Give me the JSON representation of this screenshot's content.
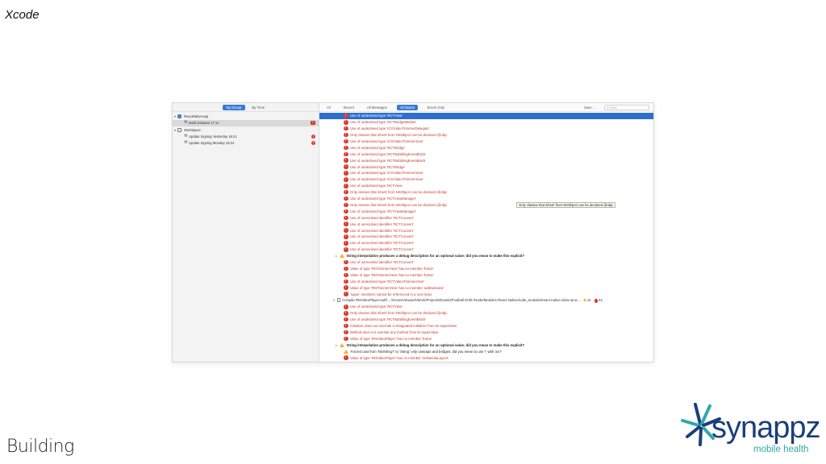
{
  "slide": {
    "title": "Xcode",
    "footer": "Building"
  },
  "navigator": {
    "segments": [
      "By Group",
      "By Time"
    ],
    "active_segment": "By Group",
    "rows": [
      {
        "label": "ReactNativeApp",
        "kind": "project",
        "indent": 0
      },
      {
        "label": "Build Dalsetar 17:11",
        "kind": "build",
        "indent": 1,
        "selected": true,
        "badge": "!"
      },
      {
        "label": "Workspace",
        "kind": "workspace",
        "indent": 0
      },
      {
        "label": "Update Signing Yesterday 18:41",
        "kind": "build",
        "indent": 1,
        "badge": "!"
      },
      {
        "label": "Update Signing Monday 15:24",
        "kind": "build",
        "indent": 1,
        "badge": "!"
      }
    ]
  },
  "toolbar": {
    "all": "All",
    "recent": "Recent",
    "all_messages": "All Messages",
    "all_issues": "All Issues",
    "errors_only": "Errors Only",
    "save": "Save...",
    "filter_placeholder": "Filter"
  },
  "issues": [
    {
      "type": "error",
      "text": "Use of undeclared type 'RCTView'",
      "selected": true
    },
    {
      "type": "error",
      "text": "Use of undeclared type 'RCTBridgeModule'"
    },
    {
      "type": "error",
      "text": "Use of undeclared type 'ICGVideoTrimmerDelegate'"
    },
    {
      "type": "error",
      "text": "Only classes that inherit from NSObject can be declared @objc"
    },
    {
      "type": "error",
      "text": "Use of undeclared type 'ICGVideoTrimmerView'"
    },
    {
      "type": "error",
      "text": "Use of undeclared type 'RCTBridge'"
    },
    {
      "type": "error",
      "text": "Use of undeclared type 'RCTBubblingEventBlock'"
    },
    {
      "type": "error",
      "text": "Use of undeclared type 'RCTBubblingEventBlock'"
    },
    {
      "type": "error",
      "text": "Use of undeclared type 'RCTBridge'"
    },
    {
      "type": "error",
      "text": "Use of undeclared type 'ICGVideoTrimmerView'"
    },
    {
      "type": "error",
      "text": "Use of undeclared type 'ICGVideoTrimmerView'"
    },
    {
      "type": "error",
      "text": "Use of undeclared type 'RCTView'"
    },
    {
      "type": "error",
      "text": "Only classes that inherit from NSObject can be declared @objc"
    },
    {
      "type": "error",
      "text": "Use of undeclared type 'RCTViewManager'"
    },
    {
      "type": "error",
      "text": "Only classes that inherit from NSObject can be declared @objc"
    },
    {
      "type": "error",
      "text": "Use of undeclared type 'RCTViewManager'"
    },
    {
      "type": "error",
      "text": "Use of unresolved identifier 'RCTConvert'"
    },
    {
      "type": "error",
      "text": "Use of unresolved identifier 'RCTConvert'"
    },
    {
      "type": "error",
      "text": "Use of unresolved identifier 'RCTConvert'"
    },
    {
      "type": "error",
      "text": "Use of unresolved identifier 'RCTConvert'"
    },
    {
      "type": "error",
      "text": "Use of unresolved identifier 'RCTConvert'"
    },
    {
      "type": "error",
      "text": "Use of unresolved identifier 'RCTConvert'"
    },
    {
      "type": "warning",
      "text": "String interpolation produces a debug description for an optional value; did you mean to make this explicit?"
    },
    {
      "type": "error",
      "text": "Use of unresolved identifier 'RCTConvert'"
    },
    {
      "type": "error",
      "text": "Value of type 'RNTrimmerView' has no member 'frame'"
    },
    {
      "type": "error",
      "text": "Value of type 'RNTrimmerView' has no member 'frame'"
    },
    {
      "type": "error",
      "text": "Use of undeclared type 'RCTVideoTrimmerView'"
    },
    {
      "type": "error",
      "text": "Value of type 'RNTrimmerView' has no member 'addSubview'"
    },
    {
      "type": "error",
      "text": "'super' members cannot be referenced in a root class"
    },
    {
      "type": "file",
      "text": "Compile RNVideoPlayer.swift  .../n/Users/mwaich/Work/Projects/Doveki/Football Drills  /Node/Modules React Native/node_modules/react-native-video-proc...",
      "warnings": "14",
      "errors": "24"
    },
    {
      "type": "error",
      "text": "Use of undeclared type 'RCTView'"
    },
    {
      "type": "error",
      "text": "Only classes that inherit from NSObject can be declared @objc"
    },
    {
      "type": "error",
      "text": "Use of undeclared type 'RCTBubblingEventBlock'"
    },
    {
      "type": "error",
      "text": "Initializer does not override a designated initializer from its superclass"
    },
    {
      "type": "error",
      "text": "Method does not override any method from its superclass"
    },
    {
      "type": "error",
      "text": "Value of type 'RNVideoPlayer' has no member 'frame'"
    },
    {
      "type": "warning",
      "text": "String interpolation produces a debug description for an optional value; did you mean to make this explicit?"
    },
    {
      "type": "warning-sub",
      "text": "Forced cast from 'NSString?' to 'String' only unwraps and bridges; did you mean to use '!' with 'as'?"
    },
    {
      "type": "error",
      "text": "Value of type 'RNVideoPlayer' has no member 'setNeedsLayout'"
    }
  ],
  "tooltip": "Only classes that inherit from NSObject can be declared @objc",
  "logo": {
    "word": "synappz",
    "tagline": "mobile health",
    "color_dark": "#1a3f7a",
    "color_teal": "#2eaaa8"
  }
}
